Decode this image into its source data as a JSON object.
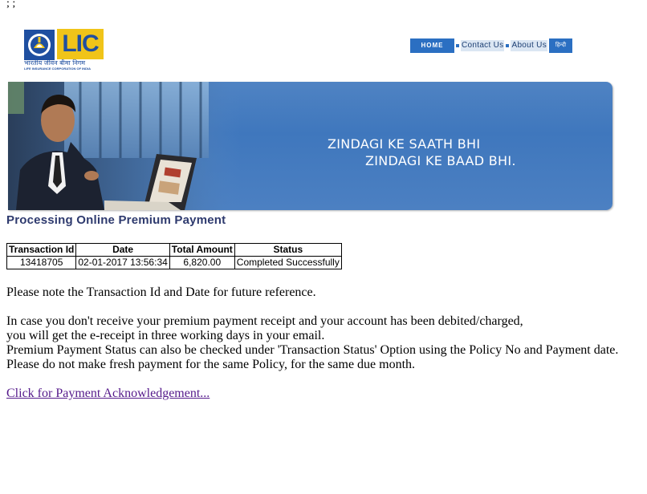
{
  "stray_text": ";   ;",
  "logo": {
    "brand": "LIC",
    "hindi": "भारतीय जीवन बीमा निगम",
    "english": "LIFE INSURANCE CORPORATION OF INDIA"
  },
  "nav": {
    "home": "HOME",
    "contact": "Contact Us",
    "about": "About Us",
    "hindi": "हिन्दी"
  },
  "banner": {
    "tagline_line1": "ZINDAGI KE SAATH BHI",
    "tagline_line2": "ZINDAGI KE BAAD BHI."
  },
  "heading": "Processing Online Premium Payment",
  "table": {
    "headers": [
      "Transaction Id",
      "Date",
      "Total Amount",
      "Status"
    ],
    "row": [
      "13418705",
      "02-01-2017 13:56:34",
      "6,820.00",
      "Completed Successfully"
    ]
  },
  "notes": {
    "note": "Please note the Transaction Id and Date for future reference.",
    "line1": "In case you don't receive your premium payment receipt and your account has been debited/charged,",
    "line2": "you will get the e-receipt in three working days in your email.",
    "line3": "Premium Payment Status can also be checked under 'Transaction Status' Option using the Policy No and Payment date.",
    "line4": "Please do not make fresh payment for the same Policy, for the same due month."
  },
  "ack_link": "Click for Payment Acknowledgement...",
  "colors": {
    "brand_blue": "#1f4fa0",
    "brand_yellow": "#f0c419",
    "banner_blue": "#4f83c3",
    "heading": "#2e3a6e",
    "visited_link": "#551a8b"
  }
}
